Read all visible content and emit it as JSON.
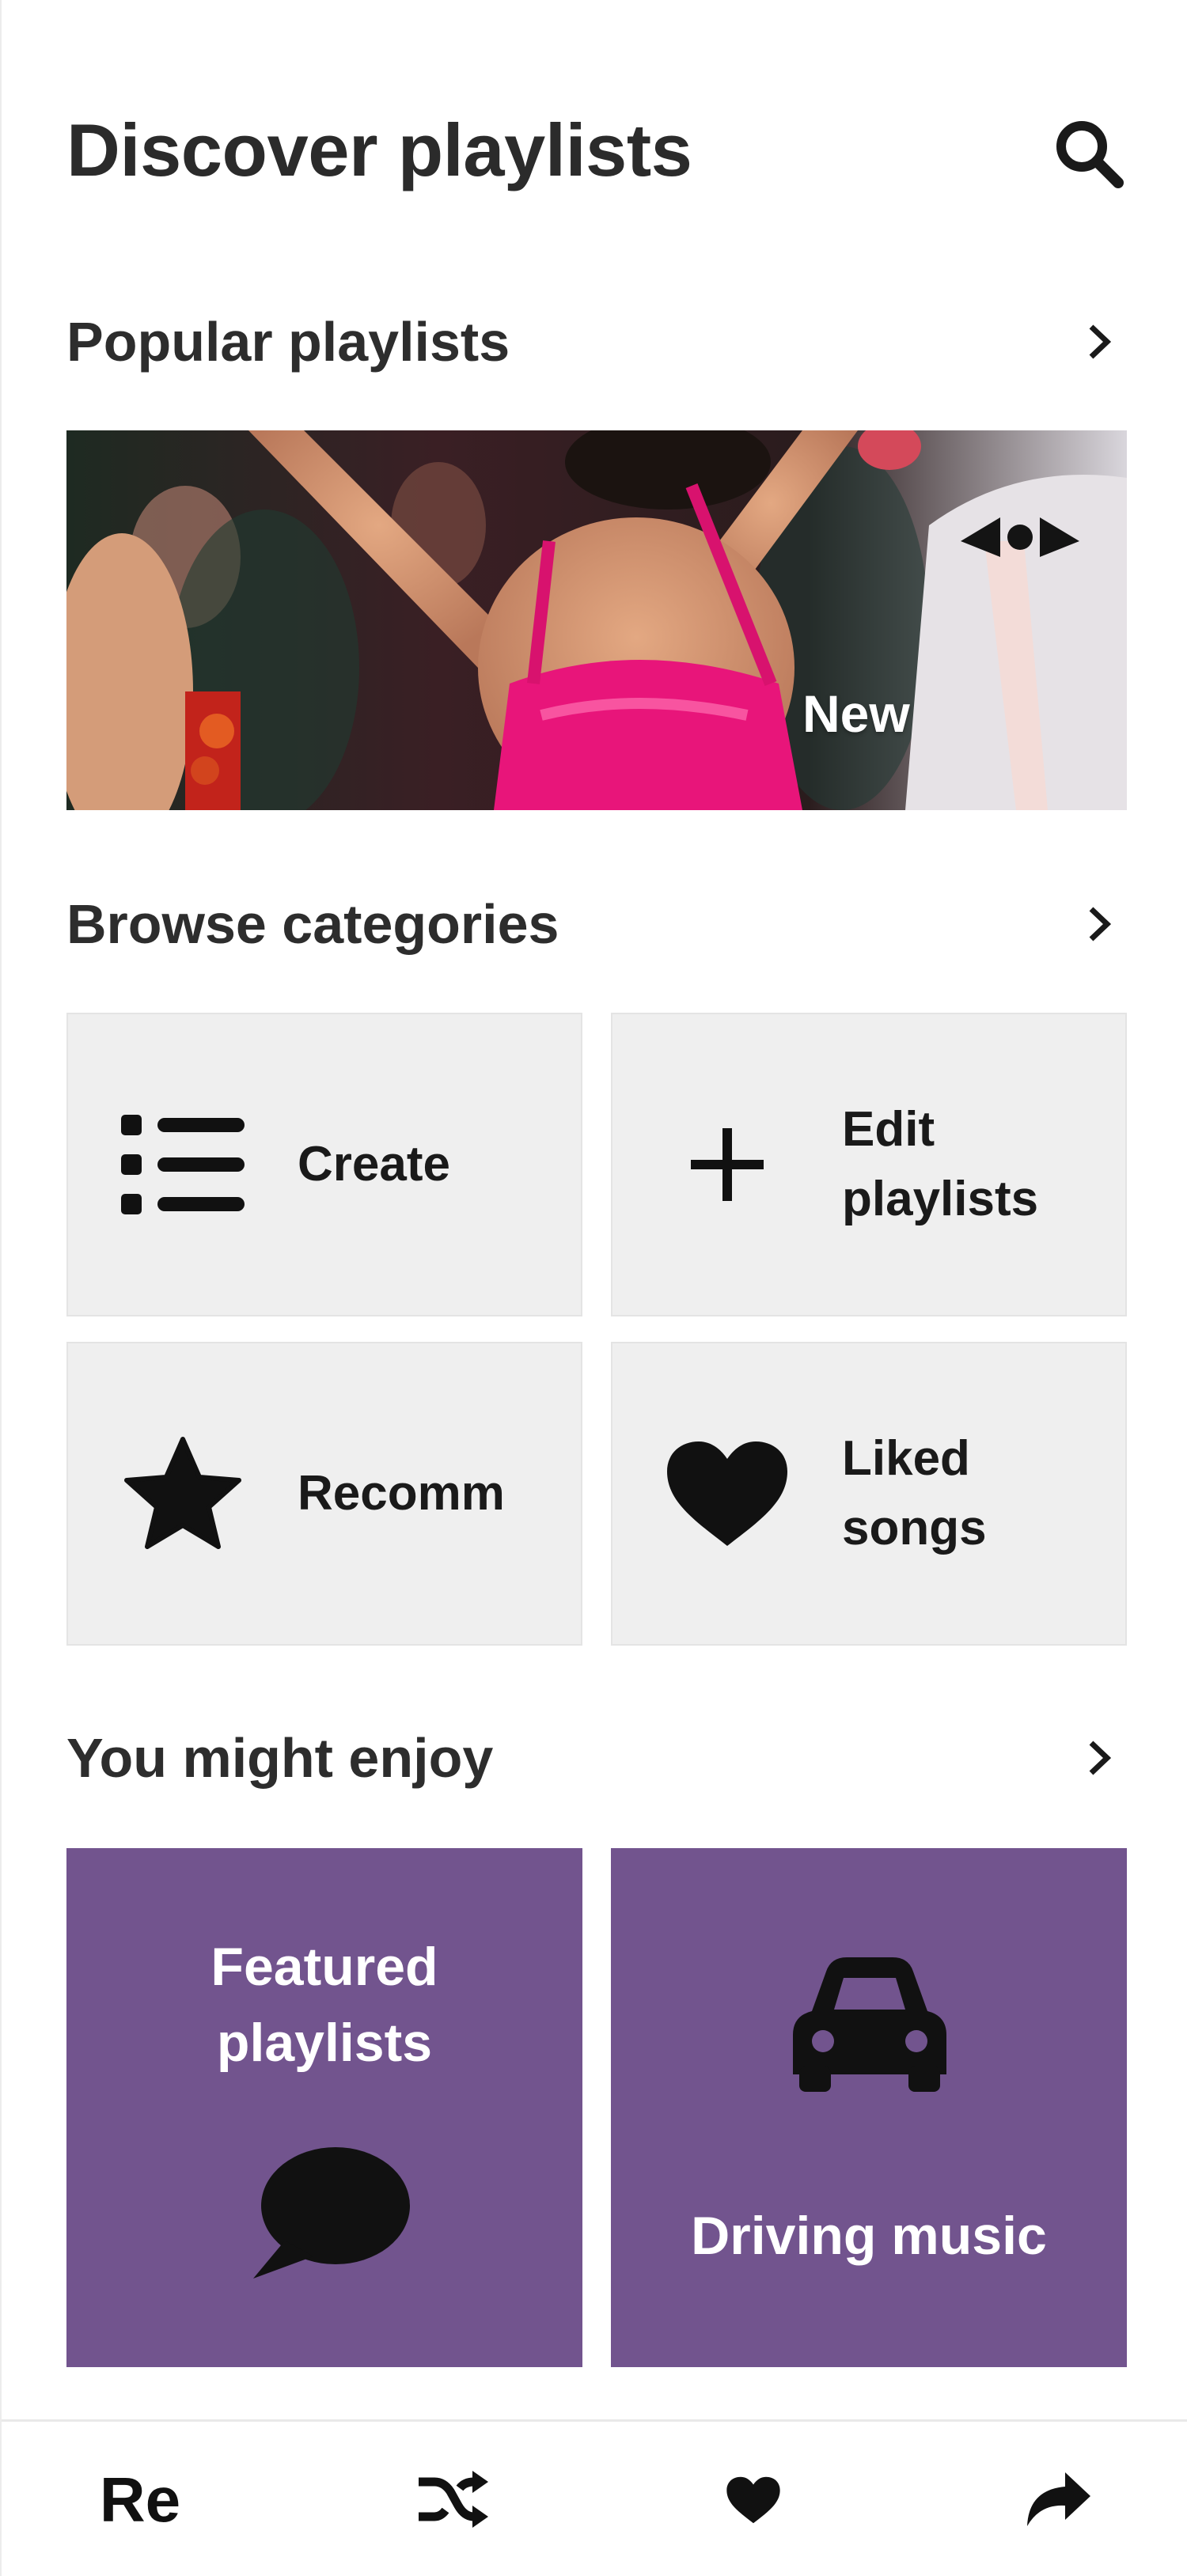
{
  "header": {
    "title": "Discover playlists",
    "search_icon": "search-icon"
  },
  "popular": {
    "title": "Popular playlists",
    "banner_label": "New",
    "icon": "chevron-right-icon"
  },
  "categories": {
    "title": "Browse categories",
    "icon": "chevron-right-icon",
    "items": [
      {
        "label": "Create",
        "icon": "list-icon"
      },
      {
        "label": "Edit\nplaylists",
        "icon": "plus-icon"
      },
      {
        "label": "Recomm",
        "icon": "star-icon"
      },
      {
        "label": "Liked\nsongs",
        "icon": "heart-icon"
      }
    ]
  },
  "enjoy": {
    "title": "You might enjoy",
    "icon": "chevron-right-icon",
    "cards": [
      {
        "label": "Featured\nplaylists",
        "icon": "speech-bubble-icon"
      },
      {
        "label": "Driving music",
        "icon": "car-icon"
      }
    ]
  },
  "bottom_nav": {
    "items": [
      {
        "label": "Re"
      },
      {
        "icon": "shuffle-icon"
      },
      {
        "icon": "heart-icon"
      },
      {
        "icon": "share-icon"
      }
    ]
  },
  "colors": {
    "tile_bg": "#efefef",
    "card_bg": "#72548e",
    "text": "#2b2b2b"
  }
}
